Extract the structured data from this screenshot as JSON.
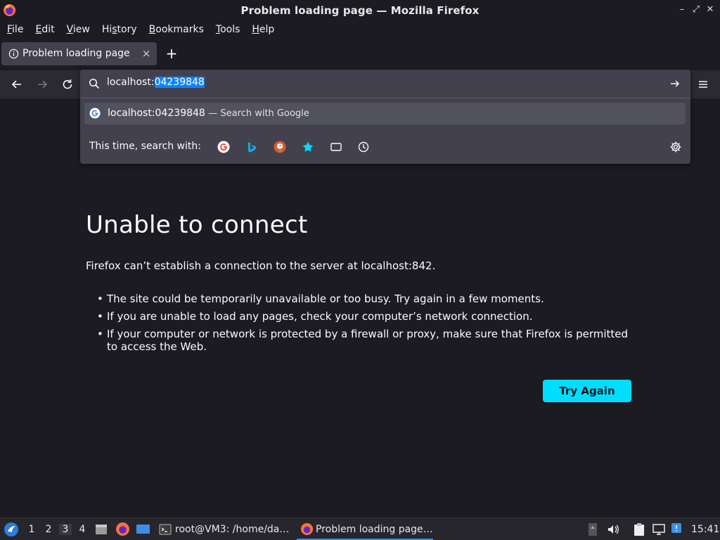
{
  "window": {
    "title": "Problem loading page — Mozilla Firefox",
    "controls": [
      "minimize-icon",
      "restore-icon",
      "close-icon"
    ]
  },
  "menubar": {
    "items": [
      {
        "label": "File",
        "mnemonic": "F"
      },
      {
        "label": "Edit",
        "mnemonic": "E"
      },
      {
        "label": "View",
        "mnemonic": "V"
      },
      {
        "label": "History",
        "mnemonic": "s"
      },
      {
        "label": "Bookmarks",
        "mnemonic": "B"
      },
      {
        "label": "Tools",
        "mnemonic": "T"
      },
      {
        "label": "Help",
        "mnemonic": "H"
      }
    ]
  },
  "tab": {
    "label": "Problem loading page",
    "icon": "info-icon",
    "close_icon": "×"
  },
  "newtab": {
    "icon": "+"
  },
  "urlbar": {
    "prefix": "localhost:",
    "selected": "04239848",
    "suggestion": {
      "text": "localhost:04239848",
      "action": "— Search with Google"
    },
    "oneoff_label": "This time, search with:",
    "engines": [
      "google-icon",
      "bing-icon",
      "duckduckgo-icon",
      "bookmarks-icon",
      "tabs-icon",
      "history-icon"
    ]
  },
  "error": {
    "title": "Unable to connect",
    "description": "Firefox can’t establish a connection to the server at localhost:842.",
    "bullets": [
      "The site could be temporarily unavailable or too busy. Try again in a few moments.",
      "If you are unable to load any pages, check your computer’s network connection.",
      "If your computer or network is protected by a firewall or proxy, make sure that Firefox is permitted to access the Web."
    ],
    "button": "Try Again"
  },
  "taskbar": {
    "workspaces": [
      "1",
      "2",
      "3",
      "4"
    ],
    "active_workspace": "3",
    "tasks": [
      {
        "label": "root@VM3: /home/da…",
        "icon": "terminal-icon"
      },
      {
        "label": "Problem loading page…",
        "icon": "firefox-icon"
      }
    ],
    "clock": "15:41"
  },
  "colors": {
    "background": "#1c1b22",
    "toolbar": "#2b2a33",
    "panel": "#42414d",
    "accent": "#00ddff",
    "selection": "#0a84ff"
  }
}
